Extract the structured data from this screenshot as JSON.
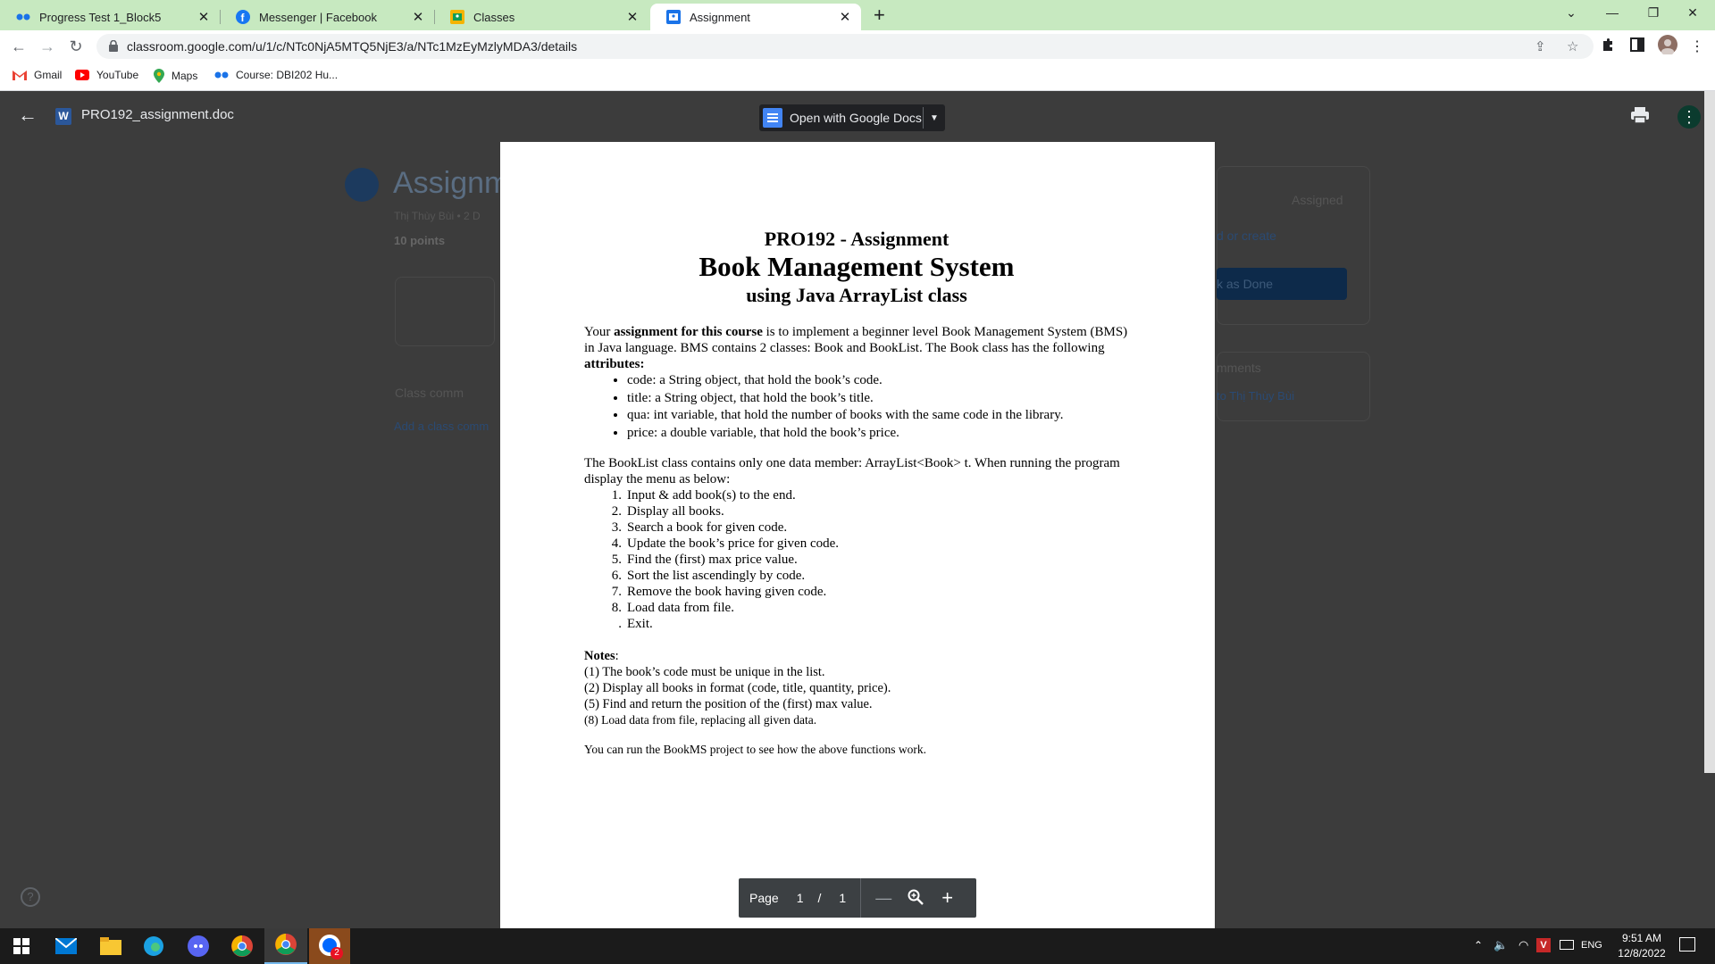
{
  "tabs": [
    {
      "title": "Progress Test 1_Block5",
      "icon": "coursera-dots-icon"
    },
    {
      "title": "Messenger | Facebook",
      "icon": "facebook-icon"
    },
    {
      "title": "Classes",
      "icon": "classroom-icon"
    },
    {
      "title": "Assignment",
      "icon": "classroom-icon",
      "active": true
    }
  ],
  "address_bar": {
    "url": "classroom.google.com/u/1/c/NTc0NjA5MTQ5NjE3/a/NTc1MzEyMzlyMDA3/details"
  },
  "bookmarks": [
    "Gmail",
    "YouTube",
    "Maps",
    "Course: DBI202 Hu..."
  ],
  "viewer": {
    "file_name": "PRO192_assignment.doc",
    "open_with": "Open with Google Docs"
  },
  "classroom_bg": {
    "title": "Assignm",
    "author": "Thị Thùy Bùi • 2 D",
    "points": "10 points",
    "class_comments": "Class comm",
    "add_comment": "Add a class comm",
    "status": "Assigned",
    "add_create": "d or create",
    "mark_done": "k as Done",
    "private_comments": "mments",
    "comment_to": "to Thị Thùy Bùi"
  },
  "document": {
    "course": "PRO192 - Assignment",
    "title": "Book Management System",
    "subtitle": "using Java ArrayList class",
    "intro_prefix": "Your ",
    "intro_bold": "assignment for this course",
    "intro_rest": " is to implement a beginner level Book Management System (BMS) in Java language. BMS contains 2 classes: Book and BookList. The Book class has the following ",
    "intro_attr_bold": "attributes:",
    "attributes": [
      "code: a String object, that hold the book’s code.",
      "title: a String object, that hold the book’s title.",
      "qua: int variable, that hold the  number of  books with the same code in the library.",
      "price: a double variable, that hold the book’s price."
    ],
    "booklist_para": "The BookList class contains only one data member: ArrayList<Book> t. When running the program display the menu as below:",
    "menu": [
      {
        "num": "1.",
        "text": "Input & add book(s) to the end."
      },
      {
        "num": "2.",
        "text": "Display all books."
      },
      {
        "num": "3.",
        "text": "Search a book for given code."
      },
      {
        "num": "4.",
        "text": "Update the book’s price for given code."
      },
      {
        "num": "5.",
        "text": "Find the (first) max price value."
      },
      {
        "num": "6.",
        "text": "Sort the list ascendingly by code."
      },
      {
        "num": "7.",
        "text": "Remove the book having given code."
      },
      {
        "num": "8.",
        "text": "Load data from file."
      },
      {
        "num": ".",
        "text": "Exit."
      }
    ],
    "notes_label": "Notes",
    "notes": [
      "(1) The book’s code must be unique in the list.",
      "(2) Display all books in format (code, title, quantity, price).",
      "(5) Find and return the position of the (first) max value.",
      "(8) Load data from file, replacing all given data."
    ],
    "footer": "You can run the BookMS project to see how the above functions work."
  },
  "page_control": {
    "label": "Page",
    "current": "1",
    "separator": "/",
    "total": "1"
  },
  "taskbar": {
    "time": "9:51 AM",
    "date": "12/8/2022",
    "lang": "ENG",
    "badge": "2"
  },
  "colors": {
    "tab_strip": "#c7e9c0",
    "viewer_bg": "#3c3c3c",
    "docs_blue": "#4285f4",
    "word_blue": "#2b579a"
  }
}
